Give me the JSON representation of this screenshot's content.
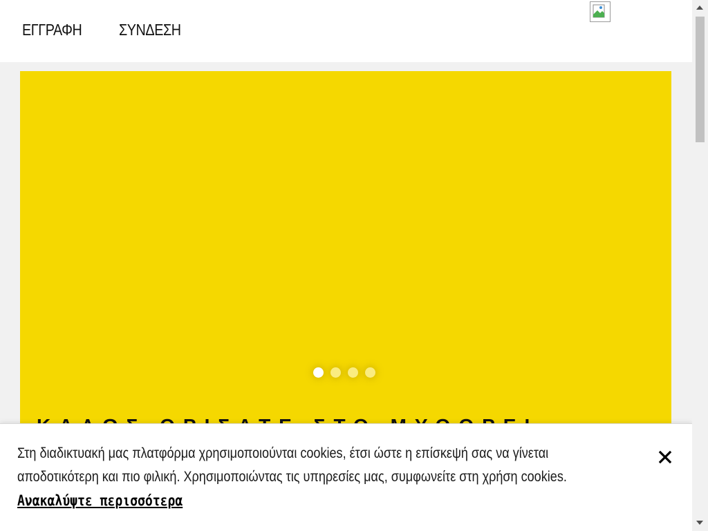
{
  "header": {
    "register_label": "ΕΓΓΡΑΦΗ",
    "login_label": "ΣΥΝΔΕΣΗ",
    "logo_icon": "broken-image-icon"
  },
  "hero": {
    "background": "#f5d800",
    "title": "ΚΑΛΩΣ ΟΡΙΣΑΤΕ ΣΤΟ ΜΥΘΟΡΕΙ",
    "slides_total": 4,
    "active_slide": 1
  },
  "cookie_banner": {
    "text": "Στη διαδικτυακή μας πλατφόρμα χρησιμοποιούνται cookies, έτσι ώστε η επίσκεψή σας να γίνεται αποδοτικότερη και πιο φιλική. Χρησιμοποιώντας τις υπηρεσίες μας, συμφωνείτε στη χρήση cookies.",
    "link_label": "Ανακαλύψτε περισσότερα",
    "close_icon": "close-icon"
  }
}
